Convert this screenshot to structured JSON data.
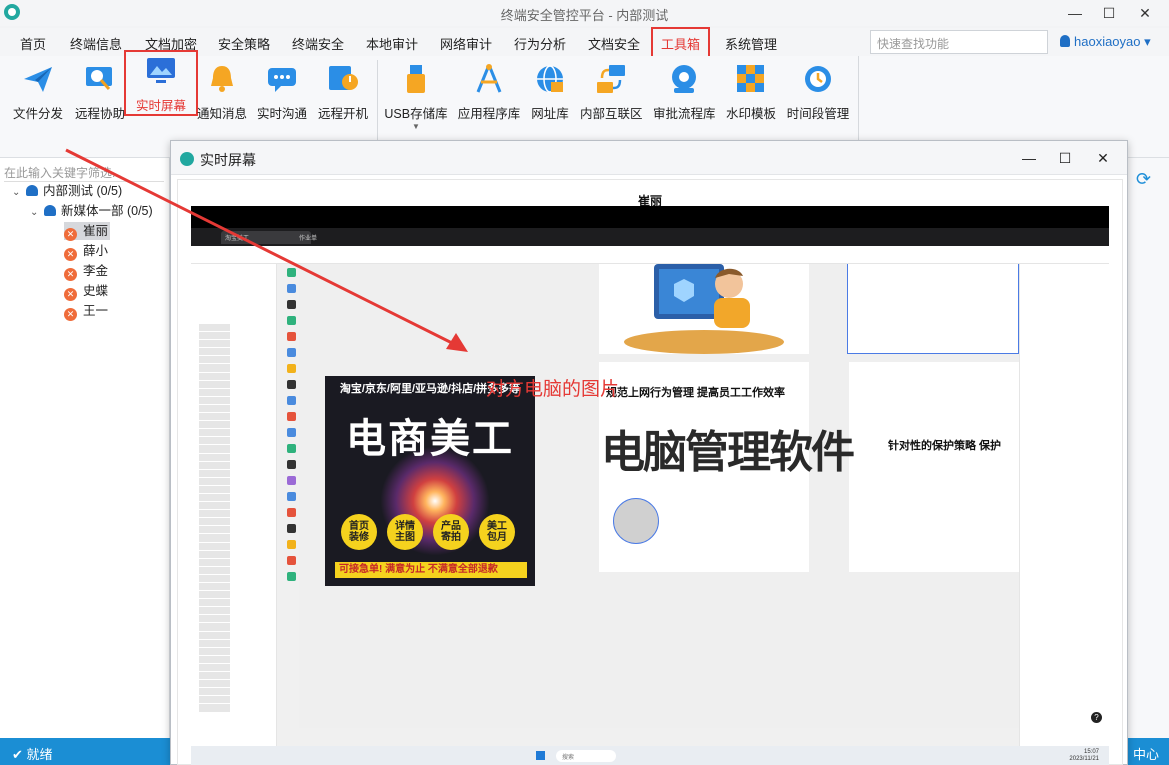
{
  "window": {
    "title": "终端安全管控平台 - 内部测试",
    "minimize": "—",
    "maximize": "☐",
    "close": "✕"
  },
  "menu": {
    "items": [
      "首页",
      "终端信息",
      "文档加密",
      "安全策略",
      "终端安全",
      "本地审计",
      "网络审计",
      "行为分析",
      "文档安全",
      "工具箱",
      "系统管理"
    ],
    "active": "工具箱",
    "search_placeholder": "快速查找功能",
    "user": "haoxiaoyao",
    "user_caret": "▾"
  },
  "ribbon": {
    "buttons": [
      {
        "label": "文件分发",
        "icon": "paper-plane-icon"
      },
      {
        "label": "远程协助",
        "icon": "remote-assist-icon"
      },
      {
        "label": "实时屏幕",
        "icon": "screen-icon"
      },
      {
        "label": "通知消息",
        "icon": "bell-icon"
      },
      {
        "label": "实时沟通",
        "icon": "chat-icon"
      },
      {
        "label": "远程开机",
        "icon": "power-on-icon"
      },
      {
        "label": "USB存储库",
        "icon": "usb-icon"
      },
      {
        "label": "应用程序库",
        "icon": "app-library-icon"
      },
      {
        "label": "网址库",
        "icon": "globe-icon"
      },
      {
        "label": "内部互联区",
        "icon": "network-icon"
      },
      {
        "label": "审批流程库",
        "icon": "approval-icon"
      },
      {
        "label": "水印模板",
        "icon": "watermark-icon"
      },
      {
        "label": "时间段管理",
        "icon": "clock-gear-icon"
      }
    ],
    "highlighted": "实时屏幕"
  },
  "tree": {
    "filter_placeholder": "在此输入关键字筛选...",
    "root": "内部测试 (0/5)",
    "group": "新媒体一部 (0/5)",
    "members": [
      "崔丽",
      "薛小",
      "李金",
      "史蝶",
      "王一"
    ],
    "selected": "崔丽"
  },
  "dialog": {
    "title": "实时屏幕",
    "minimize": "—",
    "maximize": "☐",
    "close": "✕",
    "capture_user": "崔丽",
    "annotation": "对方电脑的图片"
  },
  "remote_screen": {
    "tab1": "淘宝美工",
    "tab2": "作业单",
    "ecom_top": "淘宝/京东/阿里/亚马逊/抖店/拼多多等",
    "ecom_title": "电商美工",
    "ecom_badges": [
      "首页\n装修",
      "详情\n主图",
      "产品\n寄拍",
      "美工\n包月"
    ],
    "ecom_bottom": "可接急单! 满意为止 不满意全部退款",
    "mgr_sub": "规范上网行为管理 提高员工工作效率",
    "mgr_big": "电脑管理软件",
    "protect": "针对性的保护策略   保护",
    "taskbar_search": "搜索",
    "taskbar_time": "15:07\n2023/11/21",
    "help": "?"
  },
  "status": {
    "text": "就绪",
    "right": "中心"
  },
  "colors": {
    "accent": "#1b8ed4",
    "highlight": "#e53935",
    "status_bar": "#1b8ed4"
  }
}
